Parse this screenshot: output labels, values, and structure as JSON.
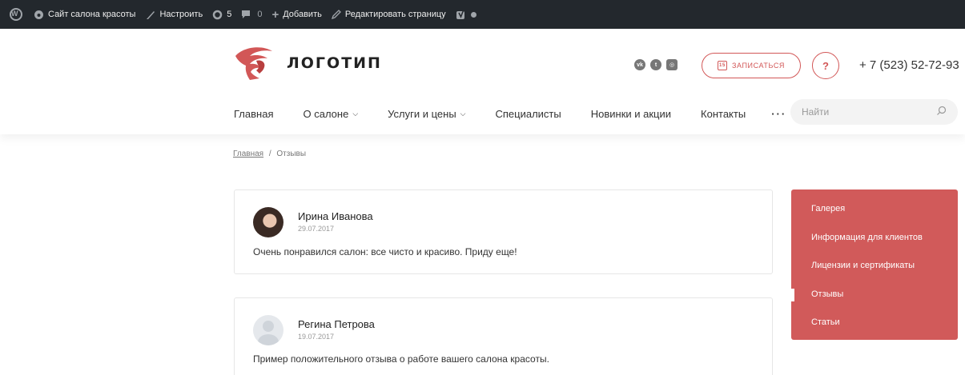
{
  "adminbar": {
    "wp_logo": "wordpress-icon",
    "site_name": "Сайт салона красоты",
    "customize": "Настроить",
    "updates_count": "5",
    "comments_count": "0",
    "add_new": "Добавить",
    "edit_page": "Редактировать страницу"
  },
  "header": {
    "logo_text": "ЛОГОТИП",
    "social": [
      "vk-icon",
      "twitter-icon",
      "instagram-icon"
    ],
    "signup_label": "ЗАПИСАТЬСЯ",
    "calendar_day": "15",
    "help_label": "?",
    "phone": "+ 7 (523) 52-72-93"
  },
  "nav": {
    "items": [
      {
        "label": "Главная",
        "dropdown": false
      },
      {
        "label": "О салоне",
        "dropdown": true
      },
      {
        "label": "Услуги и цены",
        "dropdown": true
      },
      {
        "label": "Специалисты",
        "dropdown": false
      },
      {
        "label": "Новинки и акции",
        "dropdown": false
      },
      {
        "label": "Контакты",
        "dropdown": false
      }
    ],
    "more": "···"
  },
  "search": {
    "placeholder": "Найти"
  },
  "breadcrumb": {
    "home": "Главная",
    "separator": "/",
    "current": "Отзывы"
  },
  "reviews": [
    {
      "name": "Ирина Иванова",
      "date": "29.07.2017",
      "text": "Очень понравился салон: все чисто и красиво. Приду еще!"
    },
    {
      "name": "Регина Петрова",
      "date": "19.07.2017",
      "text": "Пример положительного отзыва о работе вашего салона красоты."
    }
  ],
  "sidemenu": {
    "items": [
      "Галерея",
      "Информация для клиентов",
      "Лицензии и сертификаты",
      "Отзывы",
      "Статьи"
    ],
    "active": "Отзывы"
  },
  "colors": {
    "accent": "#d15a5a",
    "adminbar": "#23282d"
  }
}
